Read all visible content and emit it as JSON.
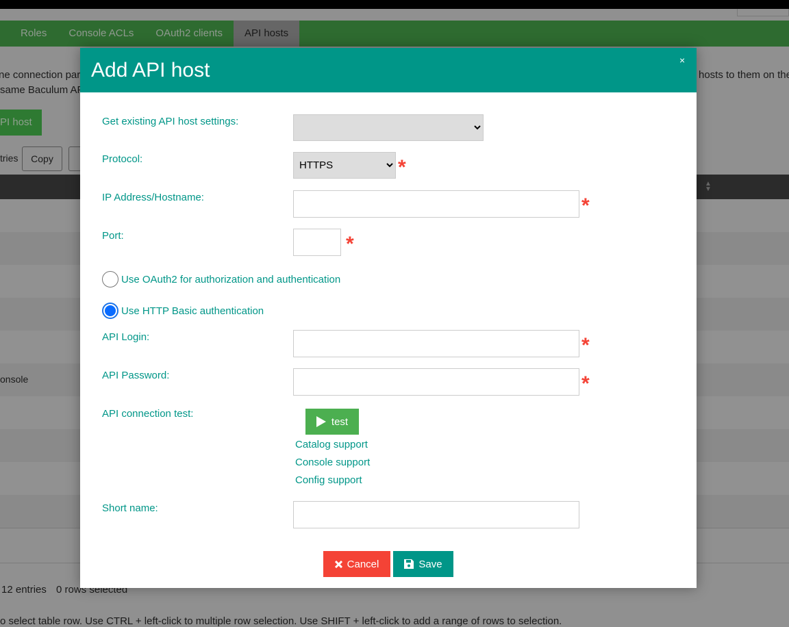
{
  "nav": {
    "tabs": [
      "Roles",
      "Console ACLs",
      "OAuth2 clients",
      "API hosts"
    ],
    "active": "API hosts"
  },
  "background": {
    "desc_line1_left": "ne connection para",
    "desc_line1_right": "hosts to them on the",
    "desc_line2_left": "same Baculum AP",
    "add_button": "PI host",
    "entries_label": "tries",
    "copy_button": "Copy",
    "row_text": "onsole",
    "info": "12 entries",
    "selected": "0 rows selected",
    "hint": "o select table row. Use CTRL + left-click to multiple row selection. Use SHIFT + left-click to add a range of rows to selection."
  },
  "modal": {
    "title": "Add API host",
    "close": "×",
    "fields": {
      "existing": {
        "label": "Get existing API host settings:",
        "value": ""
      },
      "protocol": {
        "label": "Protocol:",
        "value": "HTTPS",
        "options": [
          "HTTPS"
        ]
      },
      "host": {
        "label": "IP Address/Hostname:",
        "value": ""
      },
      "port": {
        "label": "Port:",
        "value": ""
      },
      "login": {
        "label": "API Login:",
        "value": ""
      },
      "password": {
        "label": "API Password:",
        "value": ""
      },
      "test": {
        "label": "API connection test:",
        "button": "test"
      },
      "short_name": {
        "label": "Short name:",
        "value": ""
      }
    },
    "auth": {
      "oauth2": "Use OAuth2 for authorization and authentication",
      "basic": "Use HTTP Basic authentication",
      "selected": "basic"
    },
    "support": [
      "Catalog support",
      "Console support",
      "Config support"
    ],
    "required_mark": "*",
    "cancel": "Cancel",
    "save": "Save"
  },
  "colors": {
    "accent": "#009688",
    "cancel": "#f44336",
    "test": "#4caf50",
    "required": "#f44336"
  }
}
